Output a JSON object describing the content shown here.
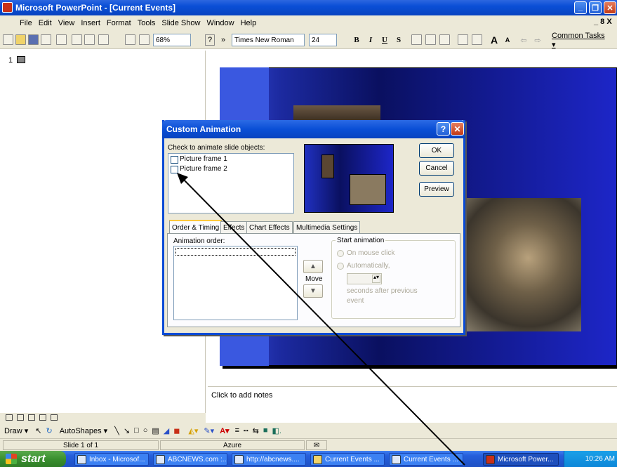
{
  "window": {
    "title": "Microsoft PowerPoint - [Current Events]",
    "controls": [
      "_",
      "□",
      "X"
    ]
  },
  "menubar": {
    "items": [
      "File",
      "Edit",
      "View",
      "Insert",
      "Format",
      "Tools",
      "Slide Show",
      "Window",
      "Help"
    ],
    "doc_controls": "_ 8 X"
  },
  "toolbar": {
    "zoom": "68%",
    "font": "Times New Roman",
    "font_size": "24",
    "bold": "B",
    "italic": "I",
    "underline": "U",
    "shadow": "S",
    "grow_font": "A",
    "shrink_font": "A",
    "common_tasks": "Common Tasks ▾",
    "more": "»",
    "help": "?"
  },
  "outline": {
    "slide_number": "1"
  },
  "notes": {
    "placeholder": "Click to add notes"
  },
  "drawbar": {
    "draw": "Draw ▾",
    "autoshapes": "AutoShapes ▾"
  },
  "status": {
    "slide": "Slide 1 of 1",
    "design": "Azure"
  },
  "taskbar": {
    "start": "start",
    "tasks": [
      {
        "label": "Inbox - Microsof...",
        "active": false
      },
      {
        "label": "ABCNEWS.com :...",
        "active": false
      },
      {
        "label": "http://abcnews....",
        "active": false
      },
      {
        "label": "Current Events ...",
        "active": false
      },
      {
        "label": "Current Events ...",
        "active": false
      },
      {
        "label": "Microsoft Power...",
        "active": true
      }
    ],
    "clock": "10:26 AM"
  },
  "dialog": {
    "title": "Custom Animation",
    "check_label": "Check to animate slide objects:",
    "objects": [
      {
        "label": "Picture frame 1",
        "checked": false
      },
      {
        "label": "Picture frame 2",
        "checked": false
      }
    ],
    "buttons": {
      "ok": "OK",
      "cancel": "Cancel",
      "preview": "Preview"
    },
    "tabs": [
      "Order & Timing",
      "Effects",
      "Chart Effects",
      "Multimedia Settings"
    ],
    "active_tab": "Order & Timing",
    "animation_order_label": "Animation order:",
    "move_label": "Move",
    "start_animation": {
      "legend": "Start animation",
      "on_mouse_click": "On mouse click",
      "automatically": "Automatically,",
      "seconds_text": "seconds after previous",
      "event_text": "event"
    }
  }
}
